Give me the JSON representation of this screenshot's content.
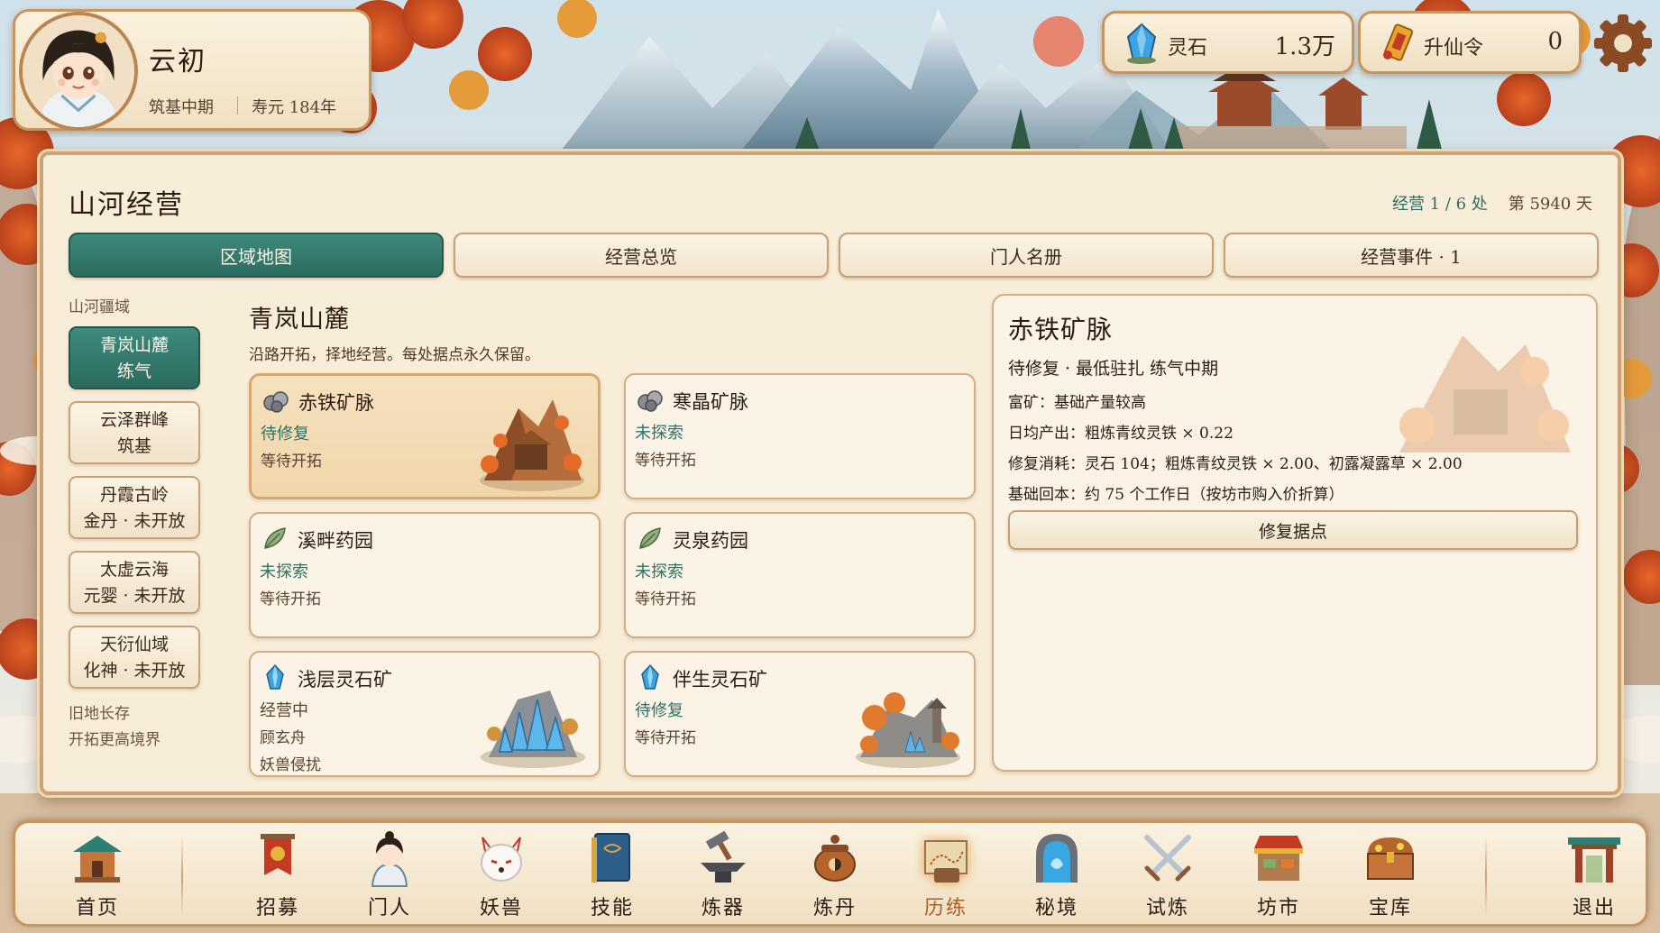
{
  "player": {
    "name": "云初",
    "realm": "筑基中期",
    "lifespan": "寿元 184年"
  },
  "resources": [
    {
      "name": "灵石",
      "value": "1.3万",
      "icon": "spirit-stone-icon"
    },
    {
      "name": "升仙令",
      "value": "0",
      "icon": "ascension-token-icon"
    }
  ],
  "panel": {
    "title": "山河经营",
    "meta_count": "经营 1 / 6 处",
    "meta_day": "第 5940 天"
  },
  "tabs": [
    {
      "label": "区域地图",
      "active": true
    },
    {
      "label": "经营总览"
    },
    {
      "label": "门人名册"
    },
    {
      "label": "经营事件 · 1"
    }
  ],
  "sidebar": {
    "heading": "山河疆域",
    "regions": [
      {
        "name": "青岚山麓",
        "tier": "练气",
        "active": true
      },
      {
        "name": "云泽群峰",
        "tier": "筑基"
      },
      {
        "name": "丹霞古岭",
        "tier": "金丹 · 未开放"
      },
      {
        "name": "太虚云海",
        "tier": "元婴 · 未开放"
      },
      {
        "name": "天衍仙域",
        "tier": "化神 · 未开放"
      }
    ],
    "footer1": "旧地长存",
    "footer2": "开拓更高境界"
  },
  "area": {
    "title": "青岚山麓",
    "desc": "沿路开拓，择地经营。每处据点永久保留。"
  },
  "sites": [
    {
      "name": "赤铁矿脉",
      "status": "待修复",
      "line1": "等待开拓",
      "line2": "",
      "icon": "ore-icon",
      "selected": true,
      "art": "mine"
    },
    {
      "name": "寒晶矿脉",
      "status": "未探索",
      "line1": "等待开拓",
      "line2": "",
      "icon": "ore-icon"
    },
    {
      "name": "溪畔药园",
      "status": "未探索",
      "line1": "等待开拓",
      "line2": "",
      "icon": "herb-leaf-icon"
    },
    {
      "name": "灵泉药园",
      "status": "未探索",
      "line1": "等待开拓",
      "line2": "",
      "icon": "herb-leaf-icon"
    },
    {
      "name": "浅层灵石矿",
      "status": "经营中",
      "line1": "顾玄舟",
      "line2": "妖兽侵扰",
      "icon": "spirit-crystal-icon",
      "art": "crystal"
    },
    {
      "name": "伴生灵石矿",
      "status": "待修复",
      "line1": "等待开拓",
      "line2": "",
      "icon": "spirit-crystal-icon",
      "art": "shrine"
    }
  ],
  "detail": {
    "title": "赤铁矿脉",
    "subtitle": "待修复 · 最低驻扎 练气中期",
    "richness": "富矿：基础产量较高",
    "output": "日均产出：粗炼青纹灵铁 × 0.22",
    "repair_cost": "修复消耗：灵石 104；粗炼青纹灵铁 × 2.00、初露凝露草 × 2.00",
    "payback": "基础回本：约 75 个工作日（按坊市购入价折算）",
    "button": "修复据点"
  },
  "nav": [
    {
      "label": "首页",
      "icon": "pavilion-home-icon"
    },
    {
      "label": "招募",
      "icon": "banner-recruit-icon"
    },
    {
      "label": "门人",
      "icon": "disciple-icon"
    },
    {
      "label": "妖兽",
      "icon": "fox-beast-icon"
    },
    {
      "label": "技能",
      "icon": "skill-book-icon"
    },
    {
      "label": "炼器",
      "icon": "anvil-hammer-icon"
    },
    {
      "label": "炼丹",
      "icon": "cauldron-icon"
    },
    {
      "label": "历练",
      "icon": "map-scroll-icon",
      "active": true
    },
    {
      "label": "秘境",
      "icon": "portal-icon"
    },
    {
      "label": "试炼",
      "icon": "crossed-swords-icon"
    },
    {
      "label": "坊市",
      "icon": "market-stall-icon"
    },
    {
      "label": "宝库",
      "icon": "treasure-chest-icon"
    },
    {
      "label": "退出",
      "icon": "gate-exit-icon"
    }
  ],
  "colors": {
    "accent": "#2e6e63",
    "frame": "#c9955e",
    "panel": "#f8edd9",
    "active_nav": "#b15a22"
  }
}
